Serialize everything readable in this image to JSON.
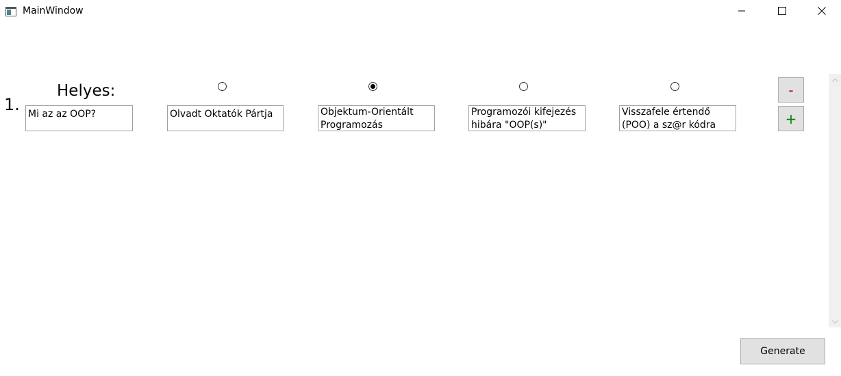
{
  "window": {
    "title": "MainWindow",
    "app_icon": "window-app-icon",
    "controls": [
      "minimize-icon",
      "maximize-icon",
      "close-icon"
    ]
  },
  "question": {
    "number": "1.",
    "correct_label": "Helyes:",
    "text": "Mi az az OOP?",
    "selected_answer_index": 1,
    "answers": [
      {
        "text": "Olvadt Oktatók Pártja",
        "selected": false
      },
      {
        "text": "Objektum-Orientált\nProgramozás",
        "selected": true
      },
      {
        "text": "Programozói kifejezés\nhibára \"OOP(s)\"",
        "selected": false
      },
      {
        "text": "Visszafele értendő\n(POO) a sz@r kódra",
        "selected": false
      }
    ]
  },
  "buttons": {
    "remove_label": "-",
    "add_label": "+",
    "generate_label": "Generate"
  },
  "colors": {
    "remove": "#d00000",
    "add": "#008000",
    "button_face": "#e1e1e1"
  }
}
